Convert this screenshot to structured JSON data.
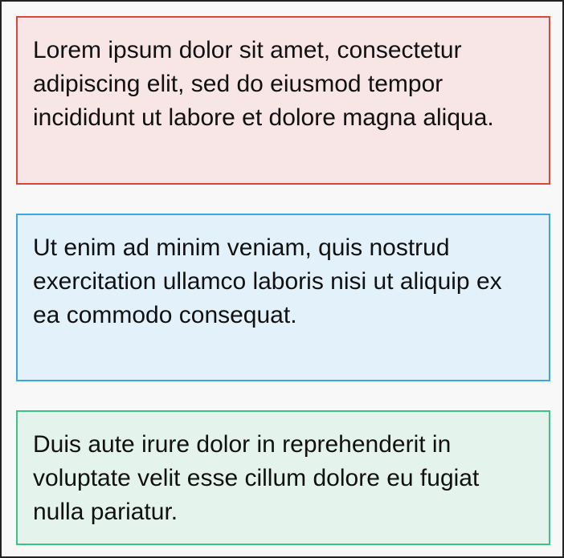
{
  "panels": [
    {
      "text": "Lorem ipsum dolor sit amet, consectetur adipiscing elit, sed do eiusmod tempor incididunt ut labore et dolore magna aliqua.",
      "background": "#f8e5e6",
      "border": "#d9483b"
    },
    {
      "text": "Ut enim ad minim veniam, quis nostrud exercitation ullamco laboris nisi ut aliquip ex ea commodo consequat.",
      "background": "#e2f1fa",
      "border": "#3aa8dc"
    },
    {
      "text": "Duis aute irure dolor in reprehenderit in voluptate velit esse cillum dolore eu fugiat nulla pariatur.",
      "background": "#e4f3eb",
      "border": "#3cc386"
    }
  ]
}
